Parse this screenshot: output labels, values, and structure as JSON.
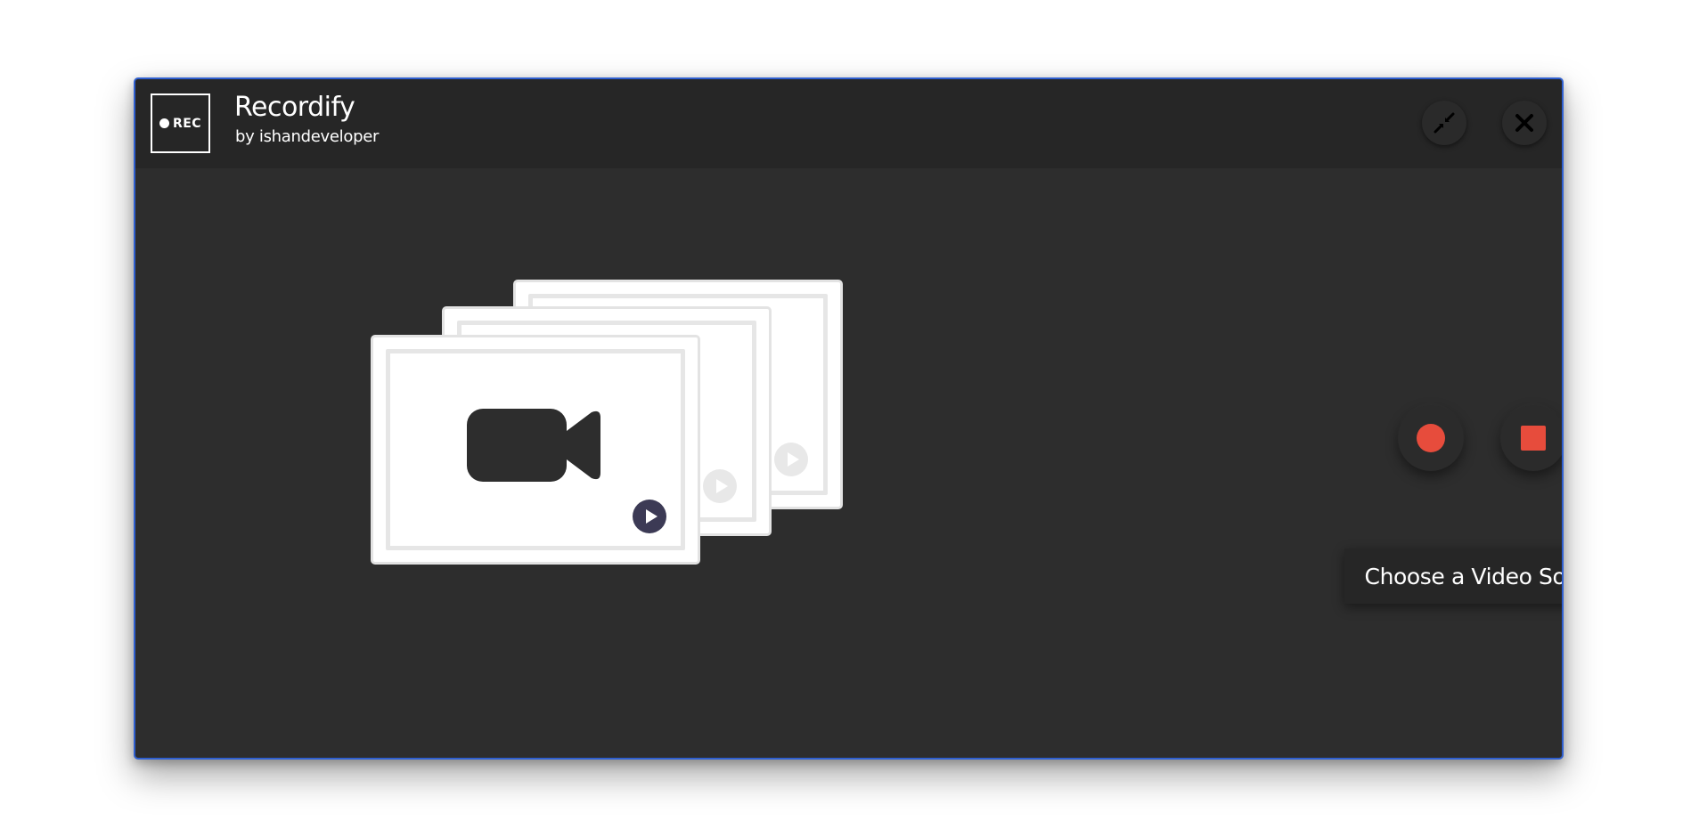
{
  "app": {
    "logo_text": "REC",
    "name": "Recordify",
    "author": "by ishandeveloper"
  },
  "title_bar": {
    "minimize_icon": "compress-arrows-icon",
    "close_icon": "close-x-icon"
  },
  "illustration": {
    "icon": "video-camera-icon",
    "play_icon": "play-circle-icon"
  },
  "controls": {
    "record_icon": "record-dot-icon",
    "stop_icon": "stop-square-icon",
    "source_button_label": "Choose a Video Source"
  },
  "colors": {
    "window_bg": "#2d2d2d",
    "title_bar_bg": "#262626",
    "accent_red": "#e74c3c",
    "window_border": "#2f5fd0",
    "play_button": "#3c3a55"
  }
}
